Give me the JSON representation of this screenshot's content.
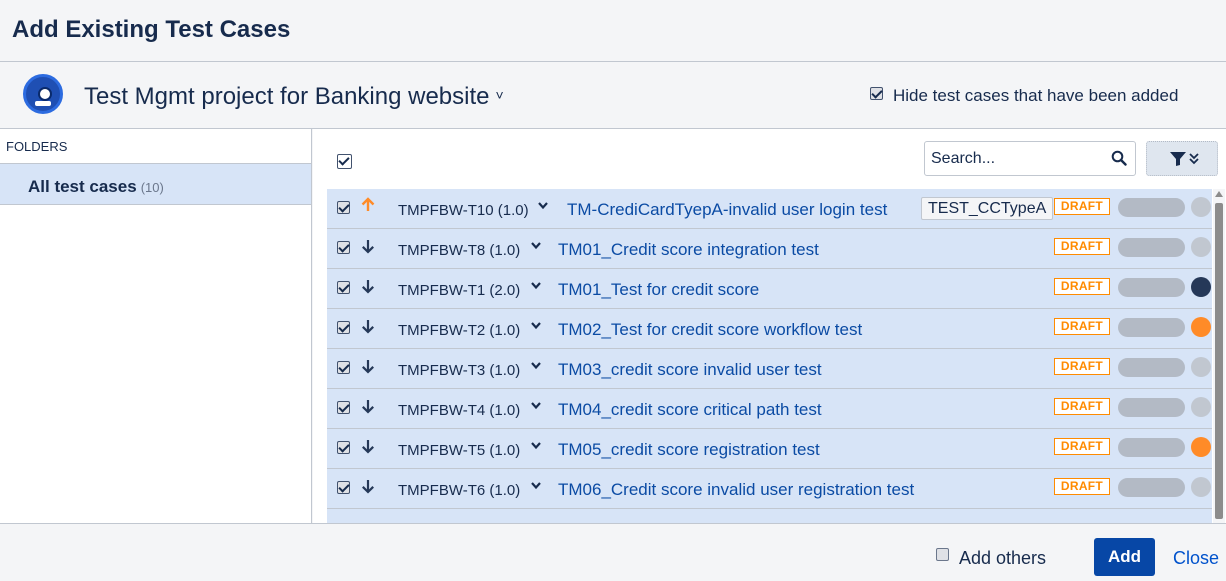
{
  "dialog": {
    "title": "Add Existing Test Cases"
  },
  "project": {
    "name": "Test Mgmt project for Banking website",
    "hide_added_label": "Hide test cases that have been added",
    "hide_added_checked": true
  },
  "sidebar": {
    "folders_label": "FOLDERS",
    "folder": {
      "name": "All test cases",
      "count": "(10)"
    }
  },
  "toolbar": {
    "search_placeholder": "Search...",
    "select_all_checked": true
  },
  "rows": [
    {
      "key": "TMPFBW-T10 (1.0)",
      "title": "TM-CrediCardTyepA-invalid user login test",
      "label": "TEST_CCTypeA",
      "status": "DRAFT",
      "priority": "high",
      "dot_color": "#c1c7d0",
      "checked": true
    },
    {
      "key": "TMPFBW-T8 (1.0)",
      "title": "TM01_Credit score integration test",
      "label": "",
      "status": "DRAFT",
      "priority": "low",
      "dot_color": "#c1c7d0",
      "checked": true
    },
    {
      "key": "TMPFBW-T1 (2.0)",
      "title": "TM01_Test for credit score",
      "label": "",
      "status": "DRAFT",
      "priority": "low",
      "dot_color": "#253858",
      "checked": true
    },
    {
      "key": "TMPFBW-T2 (1.0)",
      "title": "TM02_Test for credit score workflow test",
      "label": "",
      "status": "DRAFT",
      "priority": "low",
      "dot_color": "#ff8b28",
      "checked": true
    },
    {
      "key": "TMPFBW-T3 (1.0)",
      "title": "TM03_credit score invalid user test",
      "label": "",
      "status": "DRAFT",
      "priority": "low",
      "dot_color": "#c1c7d0",
      "checked": true
    },
    {
      "key": "TMPFBW-T4 (1.0)",
      "title": "TM04_credit score critical path test",
      "label": "",
      "status": "DRAFT",
      "priority": "low",
      "dot_color": "#c1c7d0",
      "checked": true
    },
    {
      "key": "TMPFBW-T5 (1.0)",
      "title": "TM05_credit score registration test",
      "label": "",
      "status": "DRAFT",
      "priority": "low",
      "dot_color": "#ff8b28",
      "checked": true
    },
    {
      "key": "TMPFBW-T6 (1.0)",
      "title": "TM06_Credit score invalid user registration test",
      "label": "",
      "status": "DRAFT",
      "priority": "low",
      "dot_color": "#c1c7d0",
      "checked": true
    }
  ],
  "footer": {
    "add_others_label": "Add others",
    "add_others_checked": false,
    "add_label": "Add",
    "close_label": "Close"
  },
  "colors": {
    "accent": "#0747a6",
    "draft": "#ff8b00",
    "row_bg": "#d7e4f7"
  }
}
